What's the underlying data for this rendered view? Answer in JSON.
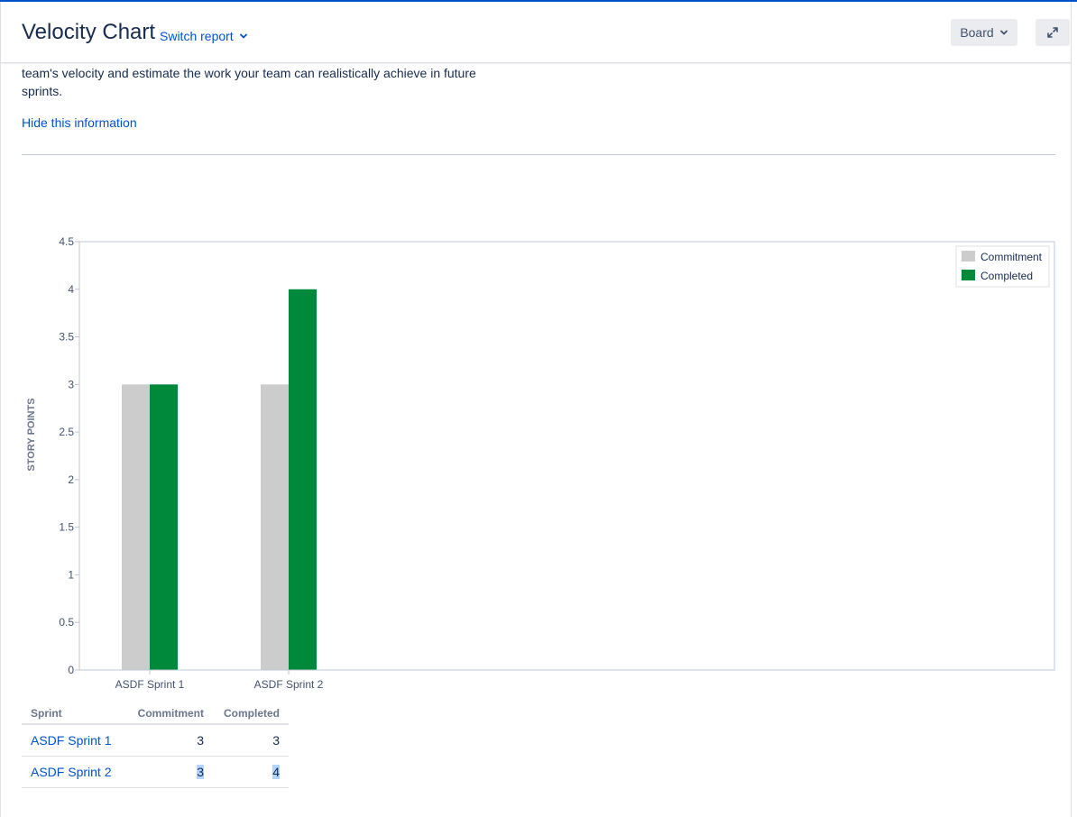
{
  "header": {
    "title": "Velocity Chart",
    "switch_report": "Switch report",
    "board_button": "Board",
    "expand_icon": "expand-icon"
  },
  "info": {
    "text_line1": "team's velocity and estimate the work your team can realistically achieve in future",
    "text_line2": "sprints.",
    "hide_link": "Hide this information"
  },
  "colors": {
    "commitment": "#cccccc",
    "completed": "#00893a",
    "link": "#0052cc"
  },
  "chart_data": {
    "type": "bar",
    "categories": [
      "ASDF Sprint 1",
      "ASDF Sprint 2"
    ],
    "series": [
      {
        "name": "Commitment",
        "values": [
          3,
          3
        ]
      },
      {
        "name": "Completed",
        "values": [
          3,
          4
        ]
      }
    ],
    "ylabel": "STORY POINTS",
    "ylim": [
      0,
      4.5
    ],
    "yticks": [
      "0",
      "0.5",
      "1",
      "1.5",
      "2",
      "2.5",
      "3",
      "3.5",
      "4",
      "4.5"
    ],
    "legend": "top-right",
    "grid": false
  },
  "table": {
    "headers": [
      "Sprint",
      "Commitment",
      "Completed"
    ],
    "rows": [
      {
        "sprint": "ASDF Sprint 1",
        "commitment": "3",
        "completed": "3"
      },
      {
        "sprint": "ASDF Sprint 2",
        "commitment": "3",
        "completed": "4"
      }
    ]
  }
}
